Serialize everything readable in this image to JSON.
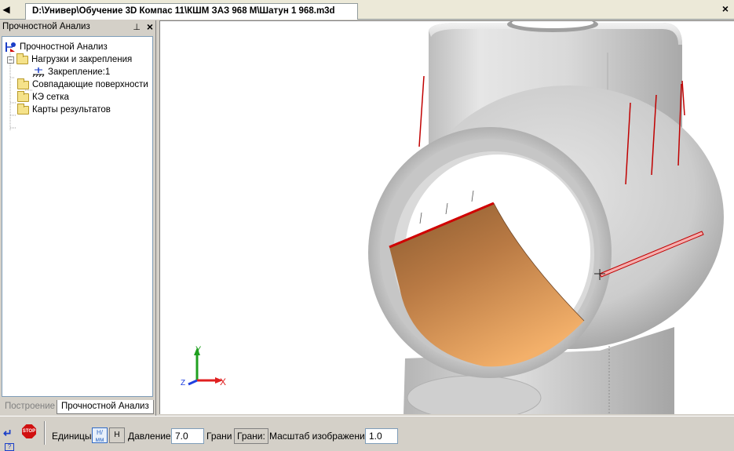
{
  "document_tab": {
    "title": "D:\\Универ\\Обучение 3D Компас 11\\КШМ ЗАЗ 968 М\\Шатун 1 968.m3d"
  },
  "panel": {
    "title": "Прочностной Анализ",
    "pin_icon": "pin-icon",
    "close_label": "×",
    "tree": {
      "root": "Прочностной Анализ",
      "loads": "Нагрузки и закрепления",
      "fixation": "Закрепление:1",
      "surfaces": "Совпадающие поверхности",
      "mesh": "КЭ сетка",
      "results": "Карты результатов"
    },
    "tabs": {
      "build": "Построение",
      "analysis": "Прочностной Анализ"
    }
  },
  "axes": {
    "x": "X",
    "y": "Y",
    "z": "Z"
  },
  "propbar": {
    "units_label": "Единицы",
    "units_btn_a": "Н/мм",
    "units_btn_b": "Н",
    "pressure_label": "Давление",
    "pressure_value": "7.0",
    "faces_label": "Грани",
    "faces_button": "Грани:",
    "scale_label": "Масштаб изображения",
    "scale_value": "1.0",
    "stop_text": "STOP",
    "help_text": "?"
  },
  "colors": {
    "load_face": "#e8a15a",
    "load_edge": "#d00000",
    "axis_x": "#e02020",
    "axis_y": "#20a020",
    "axis_z": "#2040e0",
    "part_gray": "#cfcfcf"
  }
}
